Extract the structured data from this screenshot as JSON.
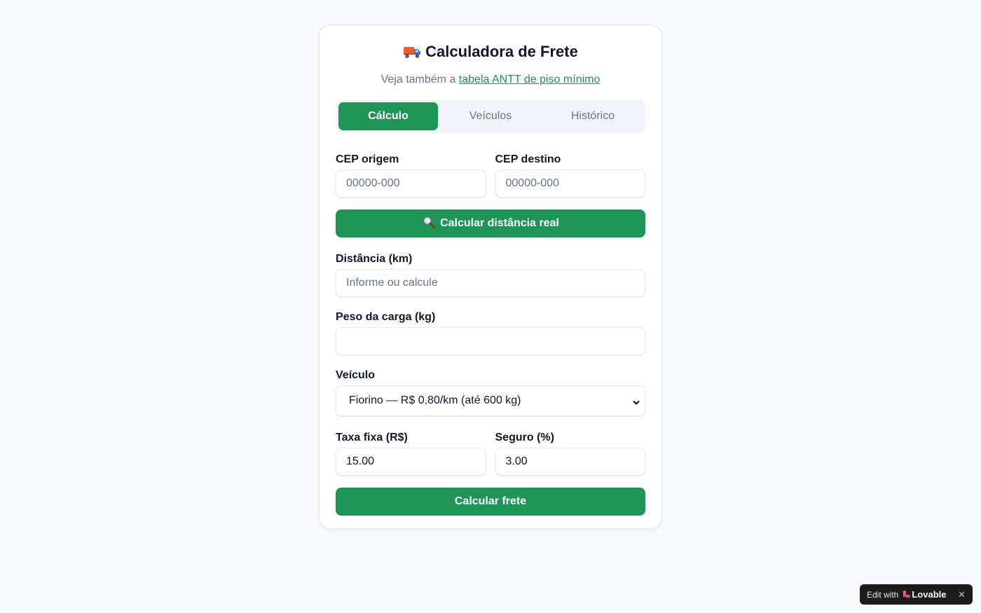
{
  "header": {
    "title": "Calculadora de Frete",
    "subtitle_prefix": "Veja também a",
    "subtitle_link": "tabela ANTT de piso mínimo"
  },
  "tabs": [
    {
      "label": "Cálculo",
      "active": true
    },
    {
      "label": "Veículos",
      "active": false
    },
    {
      "label": "Histórico",
      "active": false
    }
  ],
  "form": {
    "cep_origem": {
      "label": "CEP origem",
      "placeholder": "00000-000",
      "value": ""
    },
    "cep_destino": {
      "label": "CEP destino",
      "placeholder": "00000-000",
      "value": ""
    },
    "calc_distance_button": "Calcular distância real",
    "distancia": {
      "label": "Distância (km)",
      "placeholder": "Informe ou calcule",
      "value": ""
    },
    "peso": {
      "label": "Peso da carga (kg)",
      "placeholder": "",
      "value": ""
    },
    "veiculo": {
      "label": "Veículo",
      "selected": "Fiorino — R$ 0,80/km (até 600 kg)"
    },
    "taxa_fixa": {
      "label": "Taxa fixa (R$)",
      "value": "15.00"
    },
    "seguro": {
      "label": "Seguro (%)",
      "value": "3.00"
    },
    "submit_button": "Calcular frete"
  },
  "badge": {
    "prefix": "Edit with",
    "brand": "Lovable",
    "close": "✕"
  },
  "colors": {
    "accent": "#1e9456",
    "link": "#1f9150",
    "background": "#f8fafc"
  },
  "icons": {
    "title_icon": "truck-icon",
    "distance_button_icon": "magnifier-icon"
  }
}
